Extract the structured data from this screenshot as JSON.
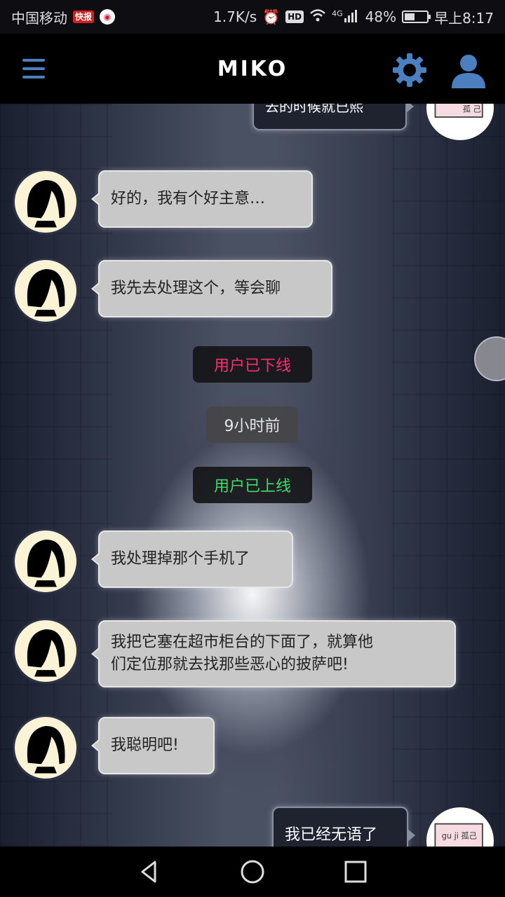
{
  "status": {
    "carrier": "中国移动",
    "badge1": "快报",
    "speed": "1.7K/s",
    "hd": "HD",
    "network": "4G",
    "battery": "48%",
    "battery_level": 0.48,
    "time": "早上8:17"
  },
  "header": {
    "title": "MIKO"
  },
  "chat": {
    "top_partial_text": "去的时候就已熙",
    "messages": [
      {
        "text": "好的，我有个好主意…"
      },
      {
        "text": "我先去处理这个，等会聊"
      },
      {
        "text": "我处理掉那个手机了"
      },
      {
        "line1": "我把它塞在超市柜台的下面了，就算他",
        "line2": "们定位那就去找那些恶心的披萨吧!"
      },
      {
        "text": "我聪明吧!"
      }
    ],
    "system": {
      "offline": "用户已下线",
      "time_ago": "9小时前",
      "online": "用户已上线"
    },
    "outgoing": {
      "text": "我已经无语了"
    },
    "user_avatar_text": "gu ji 孤己",
    "colors": {
      "offline": "#ff2d6f",
      "online": "#3ddc6b",
      "accent": "#4b7fbf"
    }
  }
}
